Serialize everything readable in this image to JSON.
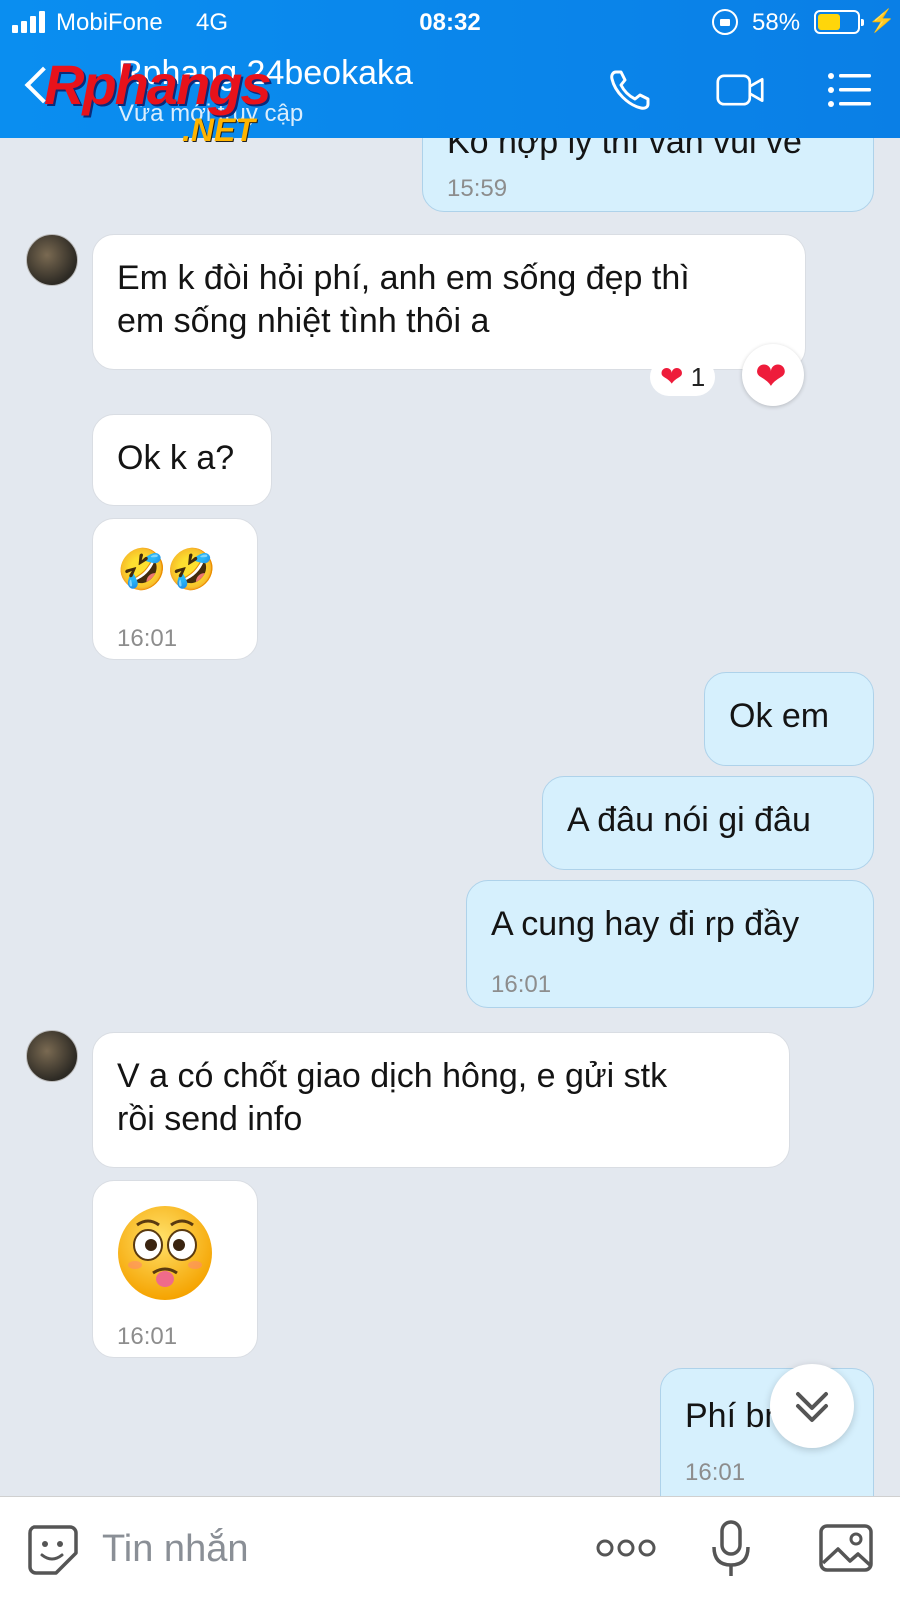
{
  "status_bar": {
    "carrier": "MobiFone",
    "network": "4G",
    "time": "08:32",
    "battery_percent": "58%",
    "battery_level": 0.58
  },
  "header": {
    "contact_name": "Rphang 24beokaka",
    "presence": "Vừa mới truy cập",
    "watermark_main": "Rphangs",
    "watermark_sub": ".NET"
  },
  "messages": [
    {
      "dir": "out",
      "text": "Ko hợp lý thì vẫn vui vẻ",
      "time": "15:59"
    },
    {
      "dir": "in",
      "line1": "Em k đòi hỏi phí, anh em sống đẹp thì",
      "line2": "em sống nhiệt tình thôi a",
      "reaction_count": "1"
    },
    {
      "dir": "in",
      "text": "Ok k a?"
    },
    {
      "dir": "in",
      "text": "🤣🤣",
      "time": "16:01"
    },
    {
      "dir": "out",
      "text": "Ok em"
    },
    {
      "dir": "out",
      "text": "A đâu nói gi đâu"
    },
    {
      "dir": "out",
      "text": "A cung hay đi rp đầy",
      "time": "16:01"
    },
    {
      "dir": "in",
      "line1": "V a có chốt giao dịch hông, e gửi stk",
      "line2": "rồi send info"
    },
    {
      "dir": "in",
      "sticker": "drooling-face",
      "time": "16:01"
    },
    {
      "dir": "out",
      "text": "Phí bn...u",
      "time": "16:01"
    }
  ],
  "composer": {
    "placeholder": "Tin nhắn"
  },
  "colors": {
    "header": "#0a8ef0",
    "outgoing_bubble": "#d6f0fd",
    "incoming_bubble": "#ffffff",
    "chat_background": "#e3e8ef"
  }
}
